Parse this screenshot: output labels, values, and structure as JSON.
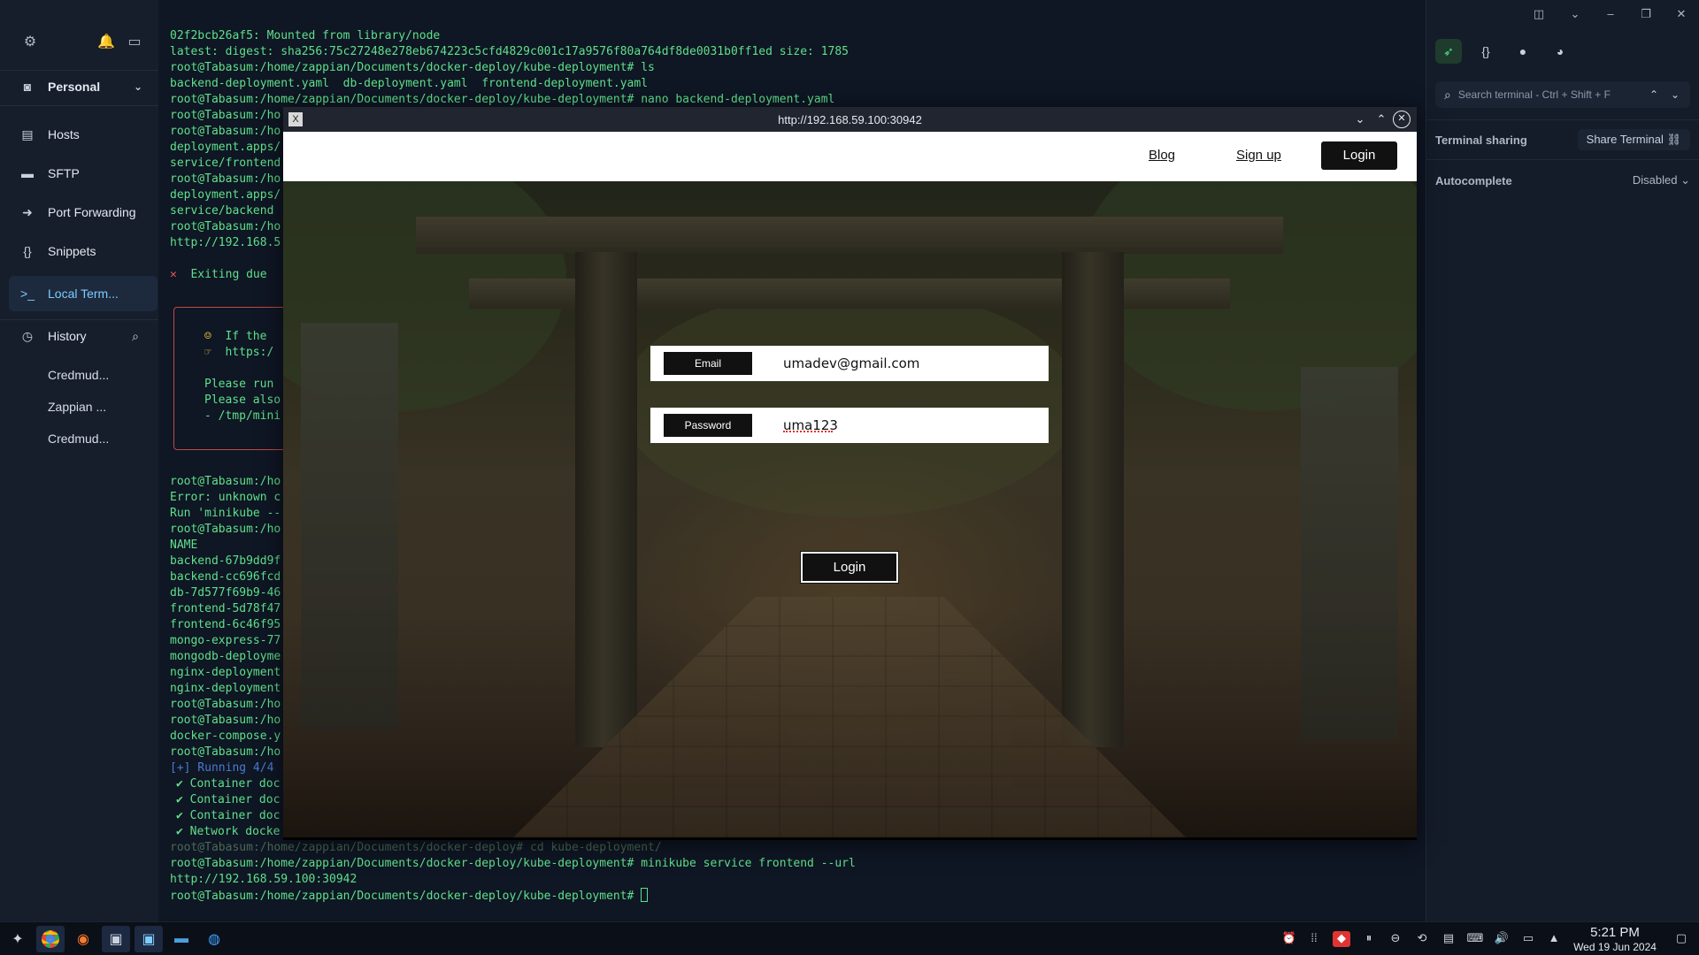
{
  "sidebar": {
    "profile": "Personal",
    "items": [
      {
        "label": "Hosts",
        "icon": "hosts-icon"
      },
      {
        "label": "SFTP",
        "icon": "folder-icon"
      },
      {
        "label": "Port Forwarding",
        "icon": "port-forwarding-icon"
      },
      {
        "label": "Snippets",
        "icon": "snippets-icon"
      },
      {
        "label": "Local Term...",
        "icon": "terminal-icon"
      }
    ],
    "history_label": "History",
    "history_items": [
      "Credmud...",
      "Zappian ...",
      "Credmud..."
    ]
  },
  "terminal": {
    "lines_top": [
      "02f2bcb26af5: Mounted from library/node",
      "latest: digest: sha256:75c27248e278eb674223c5cfd4829c001c17a9576f80a764df8de0031b0ff1ed size: 1785",
      "root@Tabasum:/home/zappian/Documents/docker-deploy/kube-deployment# ls",
      "backend-deployment.yaml  db-deployment.yaml  frontend-deployment.yaml",
      "root@Tabasum:/home/zappian/Documents/docker-deploy/kube-deployment# nano backend-deployment.yaml",
      "root@Tabasum:/ho",
      "root@Tabasum:/ho",
      "deployment.apps/",
      "service/frontend",
      "root@Tabasum:/ho",
      "deployment.apps/",
      "service/backend",
      "root@Tabasum:/ho",
      "http://192.168.5"
    ],
    "exiting": "Exiting due",
    "box_lines": [
      "If the",
      "https:/",
      "",
      "Please run",
      "Please also",
      "- /tmp/mini"
    ],
    "lines_mid": [
      "root@Tabasum:/ho",
      "Error: unknown c",
      "Run 'minikube --",
      "root@Tabasum:/ho",
      "NAME",
      "backend-67b9dd9f",
      "backend-cc696fcd",
      "db-7d577f69b9-46",
      "frontend-5d78f47",
      "frontend-6c46f95",
      "mongo-express-77",
      "mongodb-deployme",
      "nginx-deployment",
      "nginx-deployment",
      "root@Tabasum:/ho",
      "root@Tabasum:/ho",
      "docker-compose.y",
      "root@Tabasum:/ho"
    ],
    "running": "[+] Running 4/4",
    "container_lines": [
      "✔ Container doc",
      "✔ Container doc",
      "✔ Container doc",
      "✔ Network docke"
    ],
    "lines_bottom": [
      "root@Tabasum:/home/zappian/Documents/docker-deploy# cd kube-deployment/",
      "root@Tabasum:/home/zappian/Documents/docker-deploy/kube-deployment# minikube service frontend --url",
      "http://192.168.59.100:30942",
      "root@Tabasum:/home/zappian/Documents/docker-deploy/kube-deployment#"
    ]
  },
  "right_panel": {
    "search_placeholder": "Search terminal - Ctrl + Shift + F",
    "terminal_sharing_label": "Terminal sharing",
    "share_terminal_button": "Share Terminal",
    "autocomplete_label": "Autocomplete",
    "autocomplete_value": "Disabled"
  },
  "browser": {
    "url": "http://192.168.59.100:30942",
    "nav": {
      "blog": "Blog",
      "signup": "Sign up",
      "login": "Login"
    },
    "form": {
      "email_label": "Email",
      "email_value": "umadev@gmail.com",
      "password_label": "Password",
      "password_value": "uma123",
      "login_button": "Login"
    }
  },
  "taskbar": {
    "time": "5:21 PM",
    "date": "Wed 19 Jun 2024"
  },
  "colors": {
    "terminal_green": "#5fe08a",
    "active_blue": "#7ecbff",
    "error_red": "#c54747"
  }
}
